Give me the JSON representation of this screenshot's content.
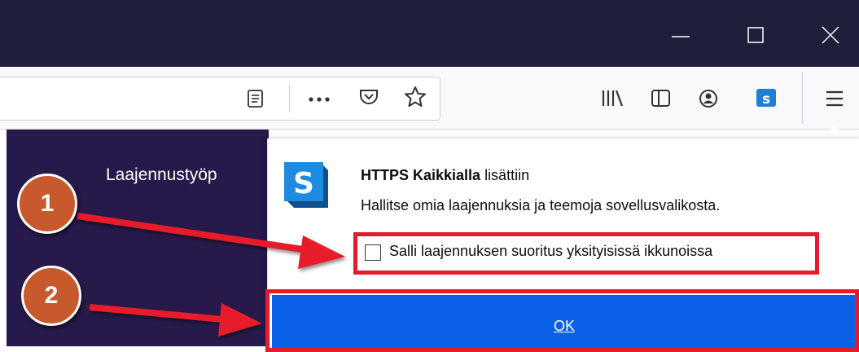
{
  "window_controls": {
    "minimize": "minimize-icon",
    "maximize": "maximize-icon",
    "close": "close-icon"
  },
  "toolbar_icons": [
    "reader-view-icon",
    "more-actions-icon",
    "pocket-icon",
    "bookmark-star-icon",
    "library-icon",
    "sidebars-icon",
    "account-icon",
    "https-everywhere-icon",
    "hamburger-menu-icon"
  ],
  "page": {
    "heading_fragment": "Laajennustyöp"
  },
  "addon_panel": {
    "icon": "https-everywhere-icon",
    "addon_name": "HTTPS Kaikkialla",
    "added_text": " lisättiin",
    "description": "Hallitse omia laajennuksia ja teemoja sovellusvalikosta.",
    "checkbox_label": "Salli laajennuksen suoritus yksityisissä ikkunoissa",
    "checkbox_checked": false,
    "ok_label": "OK"
  },
  "annotations": {
    "step1": "1",
    "step2": "2",
    "accent_color": "#e61a2b",
    "badge_color": "#c8592c"
  },
  "colors": {
    "titlebar": "#1f1f3b",
    "ok_button": "#0a60e6",
    "page_bg": "#271a4a"
  }
}
